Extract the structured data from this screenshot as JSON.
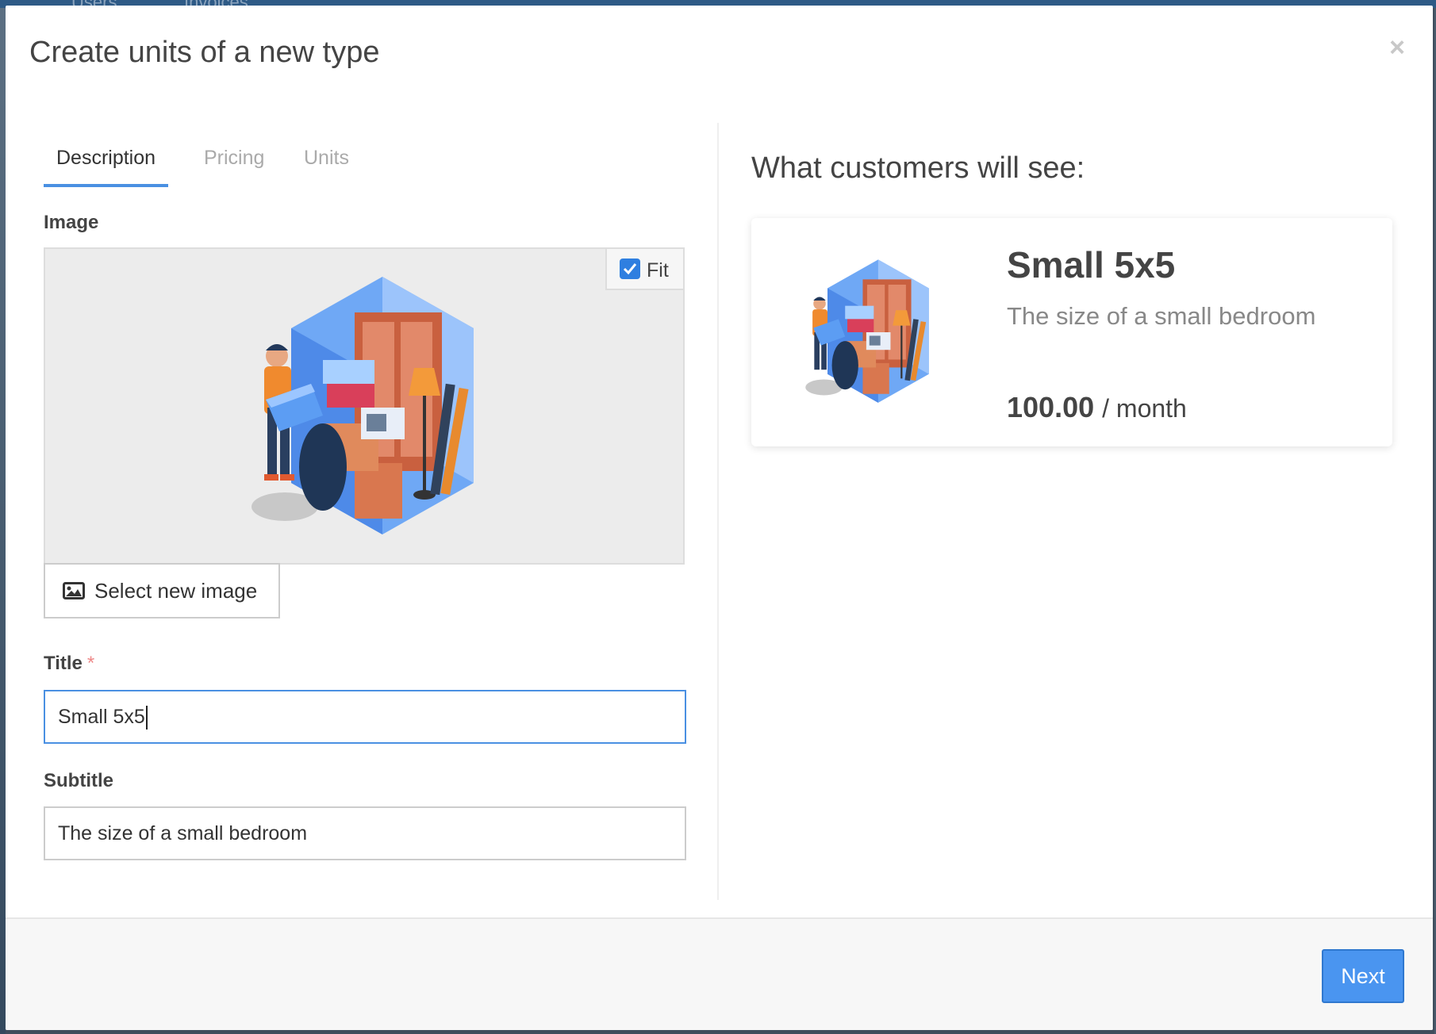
{
  "backdrop": {
    "tab_users": "Users",
    "tab_invoices": "Invoices"
  },
  "modal": {
    "title": "Create units of a new type",
    "close_symbol": "×"
  },
  "tabs": [
    {
      "label": "Description",
      "active": true
    },
    {
      "label": "Pricing",
      "active": false
    },
    {
      "label": "Units",
      "active": false
    }
  ],
  "form": {
    "image_label": "Image",
    "fit_label": "Fit",
    "fit_checked": true,
    "select_image_label": "Select new image",
    "title_label": "Title",
    "required_mark": "*",
    "title_value": "Small 5x5",
    "subtitle_label": "Subtitle",
    "subtitle_value": "The size of a small bedroom"
  },
  "preview": {
    "heading": "What customers will see:",
    "title": "Small 5x5",
    "subtitle": "The size of a small bedroom",
    "price_amount": "100.00",
    "price_period": "/ month"
  },
  "footer": {
    "next_label": "Next"
  },
  "colors": {
    "accent": "#4a90e2",
    "button_primary": "#4a95f0",
    "required": "#e88888"
  }
}
